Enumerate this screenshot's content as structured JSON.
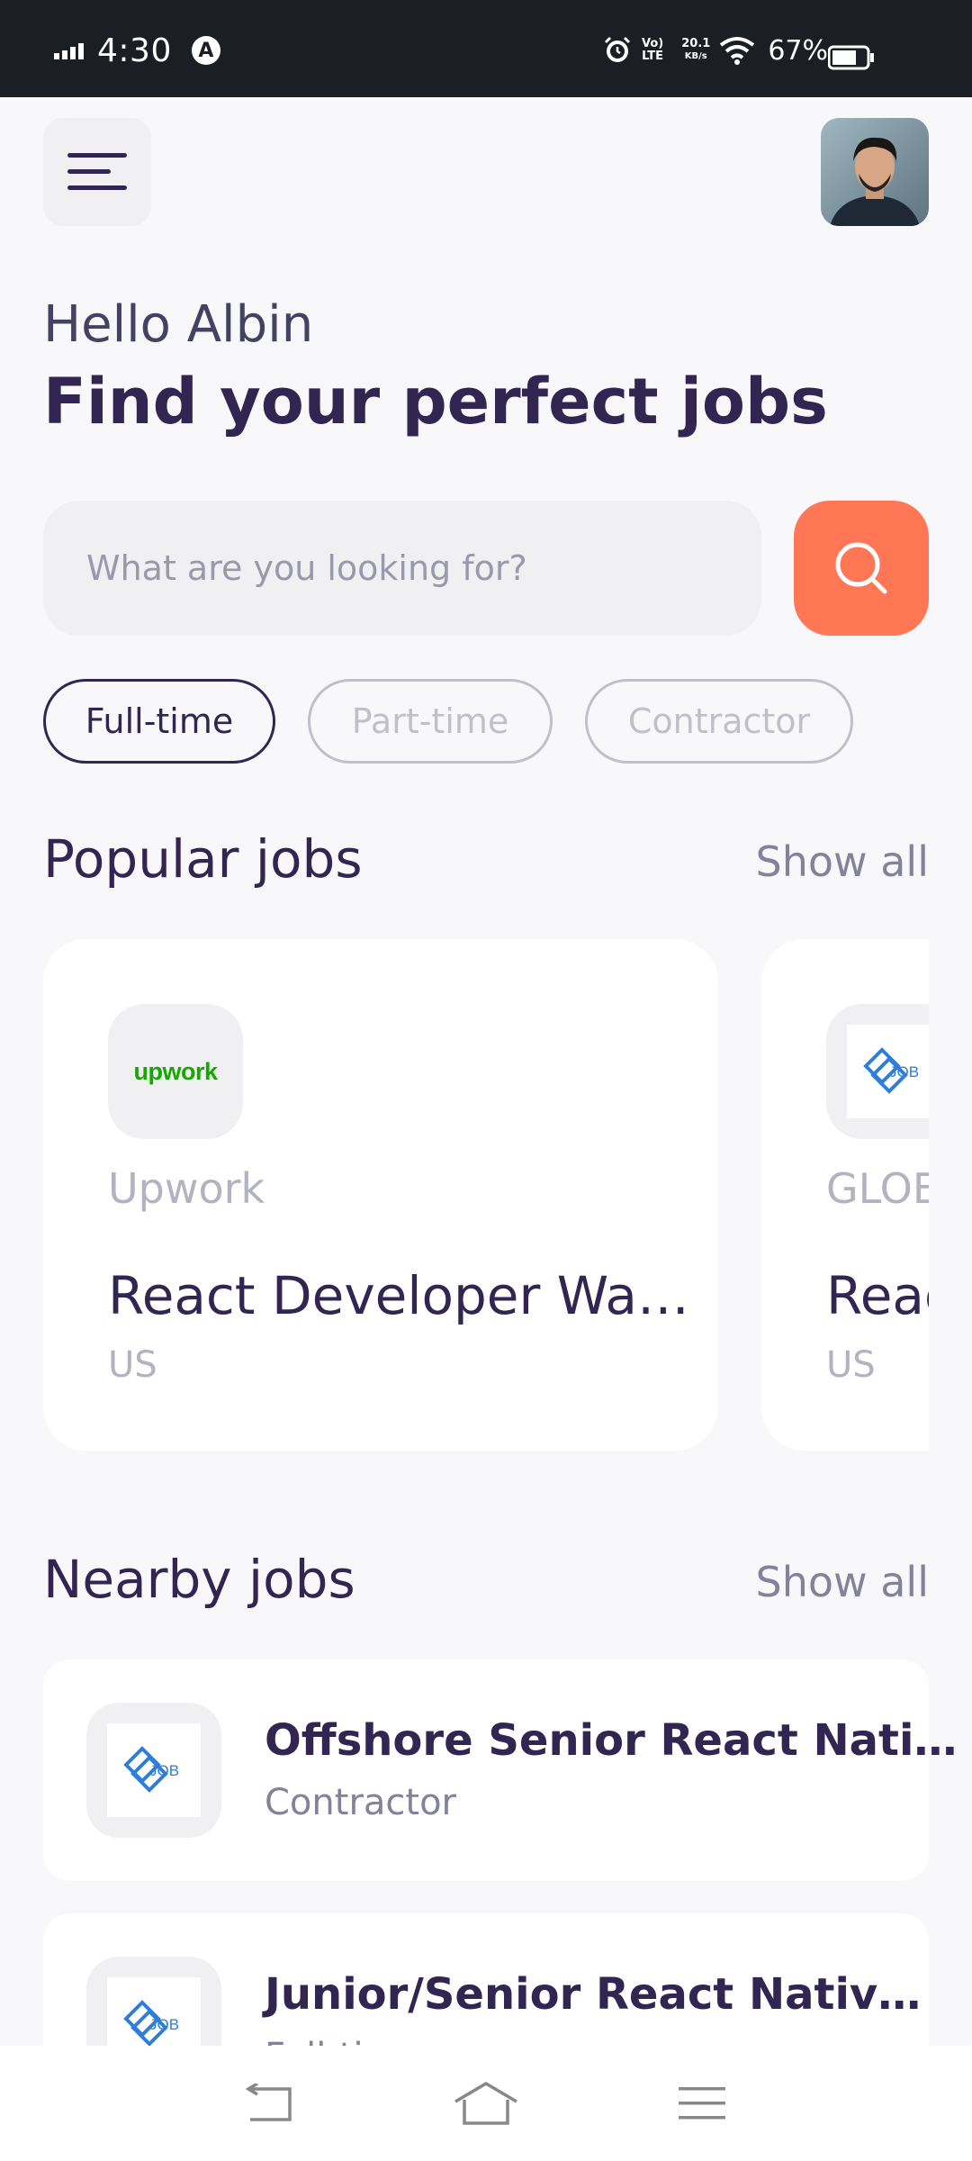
{
  "status_bar": {
    "time": "4:30",
    "volte": "Vo)\nLTE",
    "speed_value": "20.1",
    "speed_unit": "KB/s",
    "battery": "67%"
  },
  "header": {
    "menu_icon": "menu-icon",
    "avatar_alt": "Profile photo"
  },
  "welcome": {
    "greeting": "Hello Albin",
    "headline": "Find your perfect jobs"
  },
  "search": {
    "placeholder": "What are you looking for?",
    "button_icon": "search-icon"
  },
  "job_types": [
    {
      "label": "Full-time",
      "active": true
    },
    {
      "label": "Part-time",
      "active": false
    },
    {
      "label": "Contractor",
      "active": false
    }
  ],
  "popular": {
    "title": "Popular jobs",
    "show_all": "Show all",
    "cards": [
      {
        "logo": "upwork",
        "company": "Upwork",
        "title": "React Developer Wa…",
        "country": "US"
      },
      {
        "logo": "JOB",
        "company": "GLOB",
        "title": "Reac",
        "country": "US"
      }
    ]
  },
  "nearby": {
    "title": "Nearby jobs",
    "show_all": "Show all",
    "items": [
      {
        "logo": "JOB",
        "title": "Offshore Senior React Nati…",
        "type": "Contractor"
      },
      {
        "logo": "JOB",
        "title": "Junior/Senior React Nativ…",
        "type": "Full-time"
      }
    ]
  },
  "colors": {
    "primary": "#312651",
    "tertiary": "#ff7754",
    "gray": "#83829a",
    "lightWhite": "#f8f8fb",
    "upwork_green": "#14a800",
    "job_blue": "#2f7fd8"
  }
}
